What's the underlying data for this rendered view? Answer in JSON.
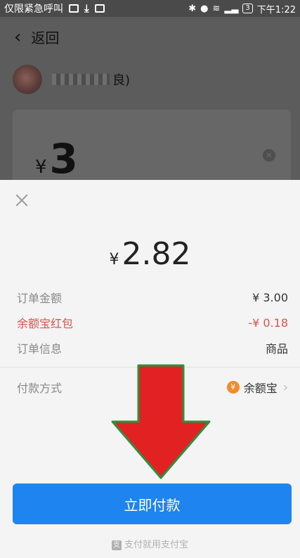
{
  "status_bar": {
    "left_text": "仅限紧急呼叫",
    "right_time": "下午1:22",
    "battery": "3"
  },
  "background": {
    "back_label": "返回",
    "name_suffix": "良)",
    "amount_currency": "¥",
    "amount_value": "3"
  },
  "sheet": {
    "currency": "¥",
    "pay_amount": "2.82",
    "rows": [
      {
        "label": "订单金额",
        "value": "¥ 3.00"
      },
      {
        "label": "余额宝红包",
        "value": "-¥ 0.18"
      },
      {
        "label": "订单信息",
        "value": "商品"
      }
    ],
    "method_label": "付款方式",
    "method_value": "余额宝",
    "method_icon": "yuebao-icon",
    "pay_button": "立即付款",
    "footer": "支付就用支付宝"
  },
  "colors": {
    "accent": "#1e84ef",
    "discount_red": "#d9534f",
    "arrow_red": "#e22222",
    "arrow_outline": "#2f8f3e"
  }
}
